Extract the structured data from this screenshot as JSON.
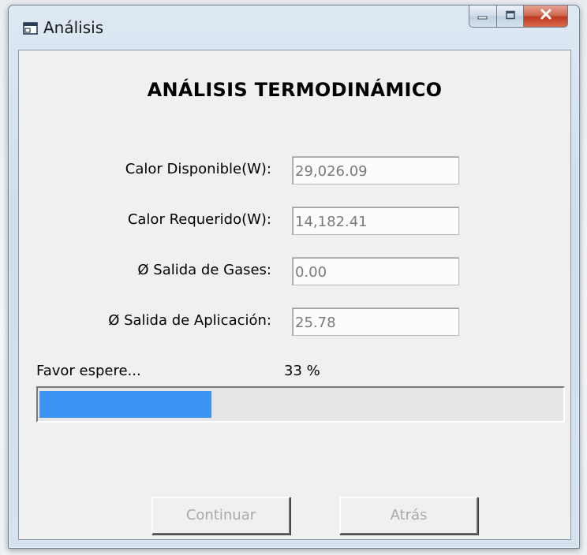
{
  "window": {
    "title": "Análisis",
    "icon": "window-app-icon"
  },
  "heading": "ANÁLISIS TERMODINÁMICO",
  "fields": [
    {
      "label": "Calor Disponible(W):",
      "value": "29,026.09"
    },
    {
      "label": "Calor Requerido(W):",
      "value": "14,182.41"
    },
    {
      "label": "Ø Salida de Gases:",
      "value": "0.00"
    },
    {
      "label": "Ø Salida de Aplicación:",
      "value": "25.78"
    }
  ],
  "status": {
    "message": "Favor espere...",
    "percent_text": "33 %",
    "progress": 0.33,
    "bar_color": "#3d94f2"
  },
  "buttons": {
    "continue_label": "Continuar",
    "back_label": "Atrás"
  },
  "colors": {
    "close_button": "#c9472c",
    "client_background": "#f0f0f0"
  }
}
